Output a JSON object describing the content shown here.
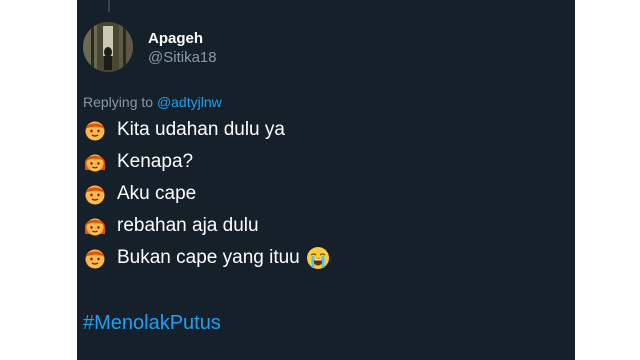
{
  "tweet": {
    "display_name": "Apageh",
    "handle": "@Sitika18",
    "reply_prefix": "Replying to",
    "reply_to": "@adtyjlnw",
    "lines": [
      {
        "icon": "boy-emoji",
        "text": "Kita udahan dulu ya"
      },
      {
        "icon": "girl-emoji",
        "text": "Kenapa?"
      },
      {
        "icon": "boy-emoji",
        "text": "Aku cape"
      },
      {
        "icon": "girl-emoji",
        "text": "rebahan aja dulu"
      },
      {
        "icon": "boy-emoji",
        "text": "Bukan cape yang ituu",
        "trailing_icon": "loudly-crying-face-emoji"
      }
    ],
    "hashtag": "#MenolakPutus"
  },
  "colors": {
    "background": "#15202b",
    "text": "#ffffff",
    "muted": "#8899a6",
    "link": "#1da1f2"
  }
}
